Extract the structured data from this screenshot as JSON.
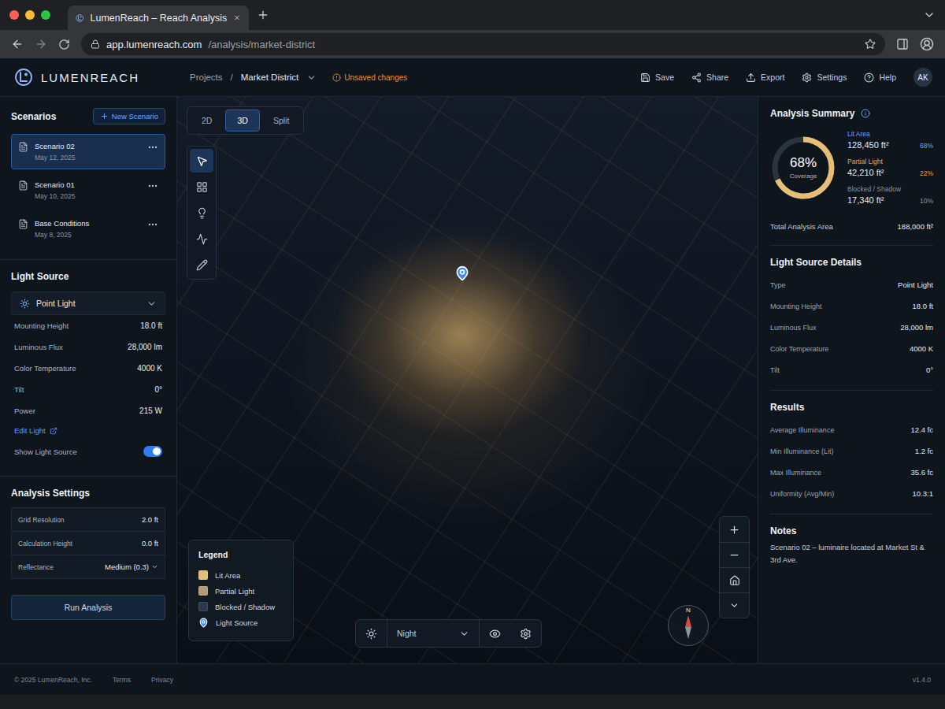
{
  "browser": {
    "tab_title": "LumenReach – Reach Analysis",
    "url_host": "app.lumenreach.com",
    "url_path": "/analysis/market-district"
  },
  "header": {
    "logo": "LUMENREACH",
    "breadcrumb": [
      "Projects",
      "Market District"
    ],
    "separator": "/",
    "status": "Unsaved changes",
    "actions": [
      "Save",
      "Share",
      "Export",
      "Settings",
      "Help"
    ],
    "avatar": "AK"
  },
  "sidebar": {
    "scenarios_title": "Scenarios",
    "new_scenario": "New Scenario",
    "scenarios": [
      {
        "name": "Scenario 02",
        "date": "May 12, 2025",
        "selected": true
      },
      {
        "name": "Scenario 01",
        "date": "May 10, 2025",
        "selected": false
      },
      {
        "name": "Base Conditions",
        "date": "May 8, 2025",
        "selected": false
      }
    ],
    "light_source": {
      "title": "Light Source",
      "type": "Point Light",
      "properties": [
        {
          "label": "Mounting Height",
          "value": "18.0 ft"
        },
        {
          "label": "Luminous Flux",
          "value": "28,000 lm"
        },
        {
          "label": "Color Temperature",
          "value": "4000 K"
        },
        {
          "label": "Tilt",
          "value": "0°"
        },
        {
          "label": "Power",
          "value": "215 W"
        }
      ],
      "edit": "Edit Light",
      "show_toggle": {
        "label": "Show Light Source",
        "on": true
      }
    },
    "analysis_settings": {
      "title": "Analysis Settings",
      "fields": [
        {
          "label": "Grid Resolution",
          "value": "2.0 ft",
          "kind": "value"
        },
        {
          "label": "Calculation Height",
          "value": "0.0 ft",
          "kind": "value"
        },
        {
          "label": "Reflectance",
          "value": "Medium (0.3)",
          "kind": "select"
        }
      ]
    },
    "run_button": "Run Analysis"
  },
  "map": {
    "view_tabs": [
      {
        "label": "2D",
        "selected": false
      },
      {
        "label": "3D",
        "selected": true
      },
      {
        "label": "Split",
        "selected": false
      }
    ],
    "tools": [
      {
        "kind": "select",
        "selected": true
      },
      {
        "kind": "grid",
        "selected": false
      },
      {
        "kind": "light",
        "selected": false
      },
      {
        "kind": "chart",
        "selected": false
      },
      {
        "kind": "pencil",
        "selected": false
      }
    ],
    "legend": {
      "title": "Legend",
      "items": [
        {
          "label": "Lit Area",
          "kind": "swatch",
          "color": "#e3bd7a"
        },
        {
          "label": "Partial Light",
          "kind": "swatch",
          "color": "#b39b78"
        },
        {
          "label": "Blocked / Shadow",
          "kind": "swatch",
          "color": "#2c3850"
        },
        {
          "label": "Light Source",
          "kind": "pin",
          "color": "#3b8ef0"
        }
      ]
    },
    "time_of_day": "Night",
    "compass": "N"
  },
  "summary": {
    "title": "Analysis Summary",
    "coverage": {
      "value": "68%",
      "label": "Coverage",
      "level": 0.68
    },
    "items": [
      {
        "label": "Lit Area",
        "area": "128,450 ft²",
        "percent": "68%",
        "color": "#6ea6ff"
      },
      {
        "label": "Partial Light",
        "area": "42,210 ft²",
        "percent": "22%",
        "color": "#e8a24a"
      },
      {
        "label": "Blocked / Shadow",
        "area": "17,340 ft²",
        "percent": "10%",
        "color": "#8a94a3"
      }
    ],
    "total": {
      "label": "Total Analysis Area",
      "value": "188,000 ft²"
    }
  },
  "details": {
    "title": "Light Source Details",
    "rows": [
      {
        "label": "Type",
        "value": "Point Light"
      },
      {
        "label": "Mounting Height",
        "value": "18.0 ft"
      },
      {
        "label": "Luminous Flux",
        "value": "28,000 lm"
      },
      {
        "label": "Color Temperature",
        "value": "4000 K"
      },
      {
        "label": "Tilt",
        "value": "0°"
      }
    ]
  },
  "results": {
    "title": "Results",
    "rows": [
      {
        "label": "Average Illuminance",
        "value": "12.4 fc"
      },
      {
        "label": "Min Illuminance (Lit)",
        "value": "1.2 fc"
      },
      {
        "label": "Max Illuminance",
        "value": "35.6 fc"
      },
      {
        "label": "Uniformity (Avg/Min)",
        "value": "10.3:1"
      }
    ]
  },
  "notes": {
    "title": "Notes",
    "text": "Scenario 02 – luminaire located at Market St & 3rd Ave."
  },
  "footer": {
    "copyright": "© 2025 LumenReach, Inc.",
    "links": [
      "Terms",
      "Privacy"
    ],
    "version": "v1.4.0"
  }
}
